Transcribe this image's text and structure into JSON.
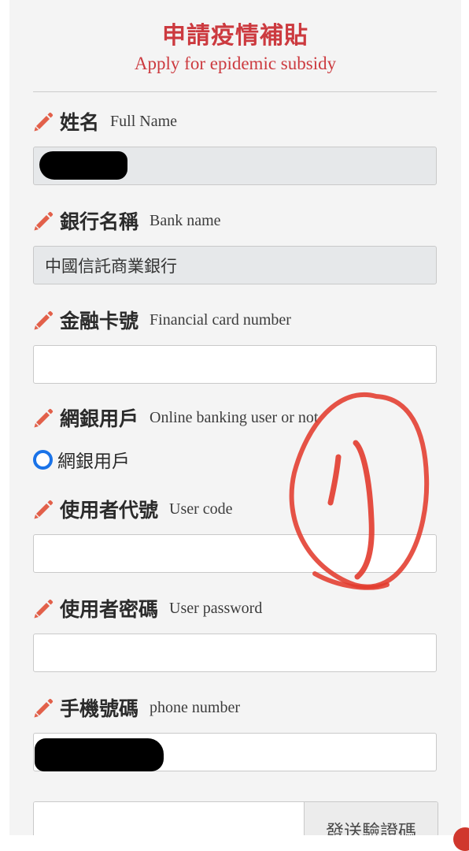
{
  "header": {
    "title": "申請疫情補貼",
    "subtitle": "Apply for epidemic subsidy"
  },
  "form": {
    "full_name": {
      "label_zh": "姓名",
      "label_en": "Full Name",
      "value": ""
    },
    "bank_name": {
      "label_zh": "銀行名稱",
      "label_en": "Bank name",
      "value": "中國信託商業銀行"
    },
    "card_number": {
      "label_zh": "金融卡號",
      "label_en": "Financial card number",
      "value": ""
    },
    "online_banking": {
      "label_zh": "網銀用戶",
      "label_en": "Online banking user or not",
      "option_label": "網銀用戶",
      "selected": true
    },
    "user_code": {
      "label_zh": "使用者代號",
      "label_en": "User code",
      "value": ""
    },
    "user_password": {
      "label_zh": "使用者密碼",
      "label_en": "User password",
      "value": ""
    },
    "phone_number": {
      "label_zh": "手機號碼",
      "label_en": "phone number",
      "value": ""
    },
    "verification": {
      "value": "",
      "send_button_label": "發送驗證碼"
    }
  },
  "icons": {
    "label_icon": "pencil-icon",
    "radio_icon": "radio-selected-icon"
  },
  "colors": {
    "title": "#cc3a3f",
    "pencil": "#e2604a",
    "radio": "#1a73e8",
    "readonly_field": "#e6e8ea",
    "annotation_stroke": "#e23b2e",
    "redaction": "#000000"
  }
}
